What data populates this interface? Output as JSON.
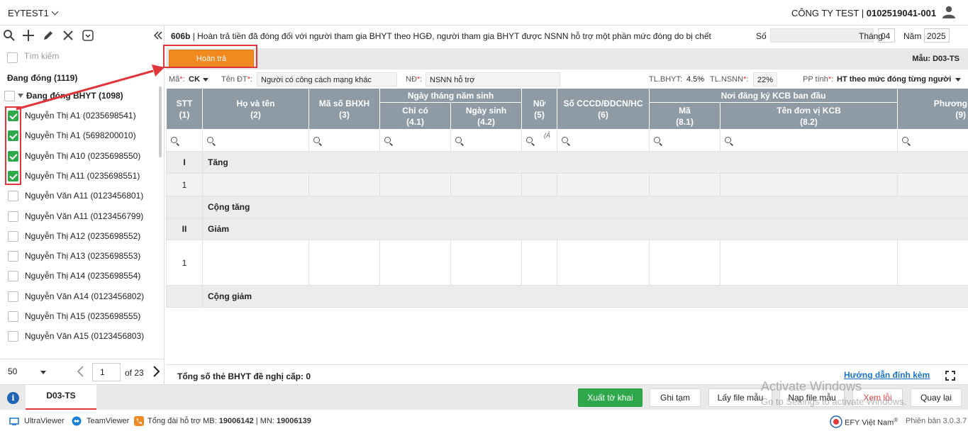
{
  "topbar": {
    "app_name": "EYTEST1",
    "company_name": "CÔNG TY TEST | ",
    "tax_code": "0102519041-001"
  },
  "left_panel": {
    "search_placeholder": "Tìm kiếm",
    "group_title": "Đang đóng (1119)",
    "subgroup_title": "Đang đóng BHYT (1098)",
    "items": [
      {
        "label": "Nguyễn Thị A1 (0235698541)",
        "checked": true
      },
      {
        "label": "Nguyễn Thị A1 (5698200010)",
        "checked": true
      },
      {
        "label": "Nguyễn Thị A10 (0235698550)",
        "checked": true
      },
      {
        "label": "Nguyễn Thị A11 (0235698551)",
        "checked": true
      },
      {
        "label": "Nguyễn Văn A11 (0123456801)",
        "checked": false
      },
      {
        "label": "Nguyễn Văn A11 (0123456799)",
        "checked": false
      },
      {
        "label": "Nguyễn Thị A12 (0235698552)",
        "checked": false
      },
      {
        "label": "Nguyễn Thị A13 (0235698553)",
        "checked": false
      },
      {
        "label": "Nguyễn Thị A14 (0235698554)",
        "checked": false
      },
      {
        "label": "Nguyễn Văn A14 (0123456802)",
        "checked": false
      },
      {
        "label": "Nguyễn Thị A15 (0235698555)",
        "checked": false
      },
      {
        "label": "Nguyễn Văn A15 (0123456803)",
        "checked": false
      }
    ],
    "pager": {
      "page_size": "50",
      "current_page": "1",
      "of_label": "of",
      "total_pages": "23"
    }
  },
  "form": {
    "code": "606b",
    "title": " | Hoàn trả tiền đã đóng đối với người tham gia BHYT theo HGĐ, người tham gia BHYT được NSNN hỗ trợ một phần mức đóng do bị chết",
    "so_label": "Số",
    "so_value": "",
    "thang_label": "Tháng",
    "thang_value": "04",
    "nam_label": "Năm",
    "nam_value": "2025",
    "hoan_tra_label": "Hoàn trả",
    "mau_label": "Mẫu: D03-TS"
  },
  "filters": {
    "ma_label": "Mã",
    "ma_value": "CK",
    "ten_dt_label": "Tên ĐT",
    "ten_dt_value": "Người có công cách mạng khác",
    "nd_label": "NĐ",
    "nd_value": "NSNN hỗ trợ",
    "tl_bhyt_label": "TL.BHYT:",
    "tl_bhyt_value": "4.5%",
    "tl_nsnn_label": "TL.NSNN",
    "tl_nsnn_value": "22%",
    "pp_tinh_label": "PP tính",
    "pp_tinh_value": "HT theo mức đóng từng người",
    "required_mark": "*",
    "colon": ":"
  },
  "grid": {
    "headers": {
      "stt": "STT",
      "stt_n": "(1)",
      "ho_ten": "Họ và tên",
      "ho_ten_n": "(2)",
      "ma_bhxh": "Mã số BHXH",
      "ma_bhxh_n": "(3)",
      "ngay_sinh_group": "Ngày tháng năm sinh",
      "chi_co": "Chỉ có",
      "chi_co_n": "(4.1)",
      "ngay_sinh": "Ngày sinh",
      "ngay_sinh_n": "(4.2)",
      "nu": "Nữ",
      "nu_n": "(5)",
      "cccd": "Số CCCD/ĐDCN/HC",
      "cccd_n": "(6)",
      "kcb_group": "Nơi đăng ký KCB ban đầu",
      "ma": "Mã",
      "ma_n": "(8.1)",
      "ten_kcb": "Tên đơn vị KCB",
      "ten_kcb_n": "(8.2)",
      "phuong_an": "Phương á",
      "phuong_an_n": "(9)"
    },
    "nu_filter_hint": "(Ả",
    "rows": {
      "tang_roman": "I",
      "tang_label": "Tăng",
      "tang_row_stt": "1",
      "cong_tang": "Cộng tăng",
      "giam_roman": "II",
      "giam_label": "Giảm",
      "giam_row_stt": "1",
      "cong_giam": "Cộng giảm"
    },
    "total_label": "Tổng số thẻ BHYT đề nghị cấp: 0",
    "guide_link": "Hướng dẫn đính kèm"
  },
  "bottom": {
    "doc_tab": "D03-TS",
    "buttons": {
      "xuat": "Xuất tờ khai",
      "ghi_tam": "Ghi tạm",
      "lay_file": "Lấy file mẫu",
      "nap_file": "Nạp file mẫu",
      "xem_loi": "Xem lỗi",
      "quay_lai": "Quay lại"
    }
  },
  "status": {
    "ultraviewer": "UltraViewer",
    "teamviewer": "TeamViewer",
    "hotline_prefix": "Tổng đài hỗ trợ MB: ",
    "hotline_mb": "19006142",
    "hotline_sep": " | MN: ",
    "hotline_mn": "19006139",
    "brand": "EFY Việt Nam",
    "registered": "®",
    "version": "Phiên bản 3.0.3.7"
  },
  "watermark": {
    "line1": "Activate Windows",
    "line2": "Go to Settings to activate Windows."
  },
  "colors": {
    "accent_orange": "#f0891f",
    "header_gray": "#8e9aa4",
    "green": "#2ea84a",
    "highlight_red": "#e0353b",
    "link_blue": "#1a73c7"
  },
  "icons": [
    "search-icon",
    "plus-icon",
    "pencil-icon",
    "close-icon",
    "dropdown-box-icon",
    "collapse-icon",
    "user-icon",
    "info-icon",
    "fullscreen-icon"
  ]
}
